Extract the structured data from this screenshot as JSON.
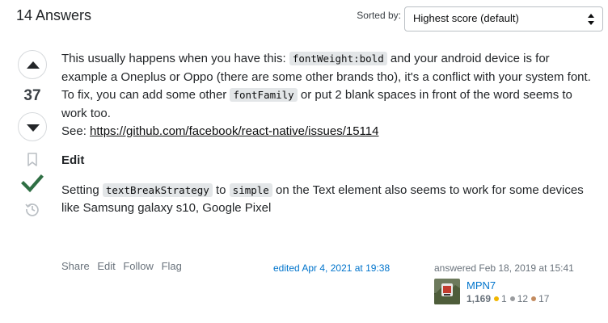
{
  "header": {
    "answers_count": "14 Answers",
    "sort_label": "Sorted by:",
    "sort_selected": "Highest score (default)"
  },
  "vote": {
    "score": "37"
  },
  "post": {
    "p1_a": "This usually happens when you have this: ",
    "p1_code": "fontWeight:bold",
    "p1_b": " and your android device is for example a Oneplus or Oppo (there are some other brands tho), it's a conflict with your system font.",
    "p2_a": "To fix, you can add some other ",
    "p2_code": "fontFamily",
    "p2_b": " or put 2 blank spaces in front of the word seems to work too.",
    "p3_label": "See: ",
    "p3_link": "https://github.com/facebook/react-native/issues/15114",
    "edit_heading": "Edit",
    "p4_a": "Setting ",
    "p4_code1": "textBreakStrategy",
    "p4_b": " to ",
    "p4_code2": "simple",
    "p4_c": " on the Text element also seems to work for some devices like Samsung galaxy s10, Google Pixel"
  },
  "menu": {
    "share": "Share",
    "edit": "Edit",
    "follow": "Follow",
    "flag": "Flag"
  },
  "edited": "edited Apr 4, 2021 at 19:38",
  "user": {
    "action": "answered Feb 18, 2019 at 15:41",
    "name": "MPN7",
    "reputation": "1,169",
    "gold": "1",
    "silver": "12",
    "bronze": "17",
    "colors": {
      "gold": "#f1b600",
      "silver": "#9a9c9f",
      "bronze": "#c38b5f"
    }
  },
  "icons": {
    "upvote": "arrow-up-icon",
    "downvote": "arrow-down-icon",
    "bookmark": "bookmark-icon",
    "accepted": "checkmark-icon",
    "history": "history-icon",
    "sort_caret": "updown-caret-icon"
  },
  "colors": {
    "accepted": "#2f6f44",
    "link": "#0074cc"
  }
}
